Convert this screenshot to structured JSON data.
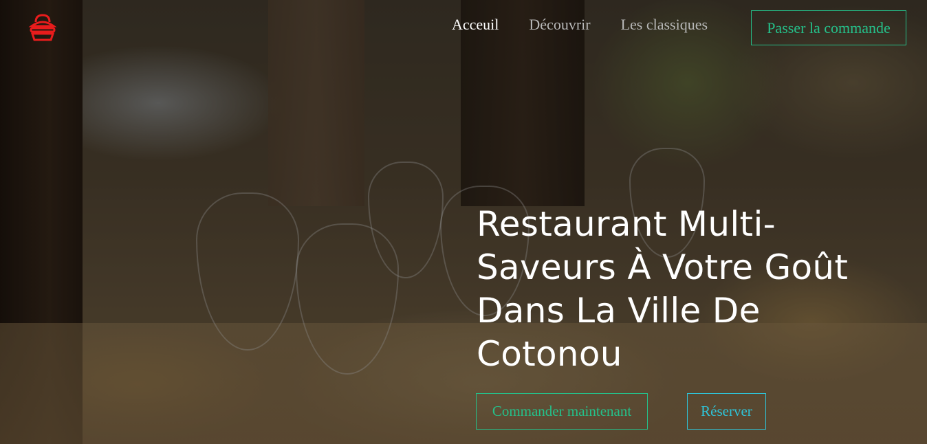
{
  "header": {
    "logo_icon": "burger-bag-icon",
    "nav": [
      {
        "label": "Acceuil",
        "active": true
      },
      {
        "label": "Découvrir",
        "active": false
      },
      {
        "label": "Les classiques",
        "active": false
      }
    ],
    "order_button_label": "Passer la commande"
  },
  "hero": {
    "title": "Restaurant Multi-Saveurs À Votre Goût Dans La Ville De Cotonou",
    "primary_button_label": "Commander maintenant",
    "secondary_button_label": "Réserver",
    "background_description_icon": "restaurant-table-photo"
  },
  "colors": {
    "accent_green": "#25c08a",
    "accent_cyan": "#2fc4d8",
    "logo_red": "#e81c1c",
    "nav_active": "#ffffff",
    "nav_inactive": "#b8b8b8"
  }
}
